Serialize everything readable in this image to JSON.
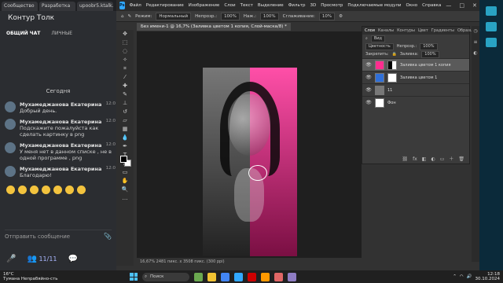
{
  "browser": {
    "tabs": [
      "Сообщество",
      "Разработка",
      "upoobr5.ktalk.ru"
    ]
  },
  "chat": {
    "title": "Контур Толк",
    "filters": [
      "ОБЩИЙ ЧАТ",
      "ЛИЧНЫЕ"
    ],
    "date_separator": "Сегодня",
    "messages": [
      {
        "author": "Мухамеджанова Екатерина",
        "text": "Добрый день.",
        "time": "12:0"
      },
      {
        "author": "Мухамеджанова Екатерина",
        "text": "Подскажите пожалуйста как сделать картинку в png",
        "time": "12:0"
      },
      {
        "author": "Мухамеджанова Екатерина",
        "text": "У меня нет в данном списке , не в одной программе , png",
        "time": "12:0"
      },
      {
        "author": "Мухамеджанова Екатерина",
        "text": "Благодарю!",
        "time": "12:0"
      }
    ],
    "input_placeholder": "Отправить сообщение",
    "members_count": "11/11"
  },
  "photoshop": {
    "logo": "Ps",
    "menu": [
      "Файл",
      "Редактирование",
      "Изображение",
      "Слои",
      "Текст",
      "Выделение",
      "Фильтр",
      "3D",
      "Просмотр",
      "Подключаемые модули",
      "Окно",
      "Справка"
    ],
    "options": {
      "mode_label": "Режим:",
      "mode_value": "Нормальный",
      "opacity_label": "Непрозр.:",
      "opacity_value": "100%",
      "flow_label": "Наж.:",
      "flow_value": "100%",
      "smoothing_label": "Сглаживание:",
      "smoothing_value": "10%"
    },
    "document_tab": "Без имени-1 @ 16,7% (Заливка цветом 1 копия, Слой-маска/8) *",
    "status": "16,67%      2481 пикс. x 3508 пикс. (300 ppi)",
    "layers_panel": {
      "tabs": [
        "Слои",
        "Каналы",
        "Контуры",
        "Цвет",
        "Градиенты",
        "Образцы"
      ],
      "search_kind": "Вид",
      "blend_mode": "Цветность",
      "opacity_label": "Непрозр.:",
      "opacity_value": "100%",
      "lock_label": "Закрепить:",
      "fill_label": "Заливка:",
      "fill_value": "100%",
      "layers": [
        {
          "name": "Заливка цветом 1 копия",
          "color": "#ff2d8f",
          "selected": true
        },
        {
          "name": "Заливка цветом 1",
          "color": "#2f6fd8",
          "selected": false
        },
        {
          "name": "11",
          "color": "#777777",
          "selected": false
        },
        {
          "name": "Фон",
          "color": "#ffffff",
          "selected": false
        }
      ]
    }
  },
  "taskbar": {
    "temperature": "16°C",
    "weather": "Тумана Непрабяйно-сть",
    "search_placeholder": "Поиск",
    "time": "12:18",
    "date": "30.10.2024"
  },
  "colors": {
    "accent_pink": "#ff2d8f",
    "accent_blue": "#2f6fd8",
    "ps_blue": "#31a8ff"
  }
}
